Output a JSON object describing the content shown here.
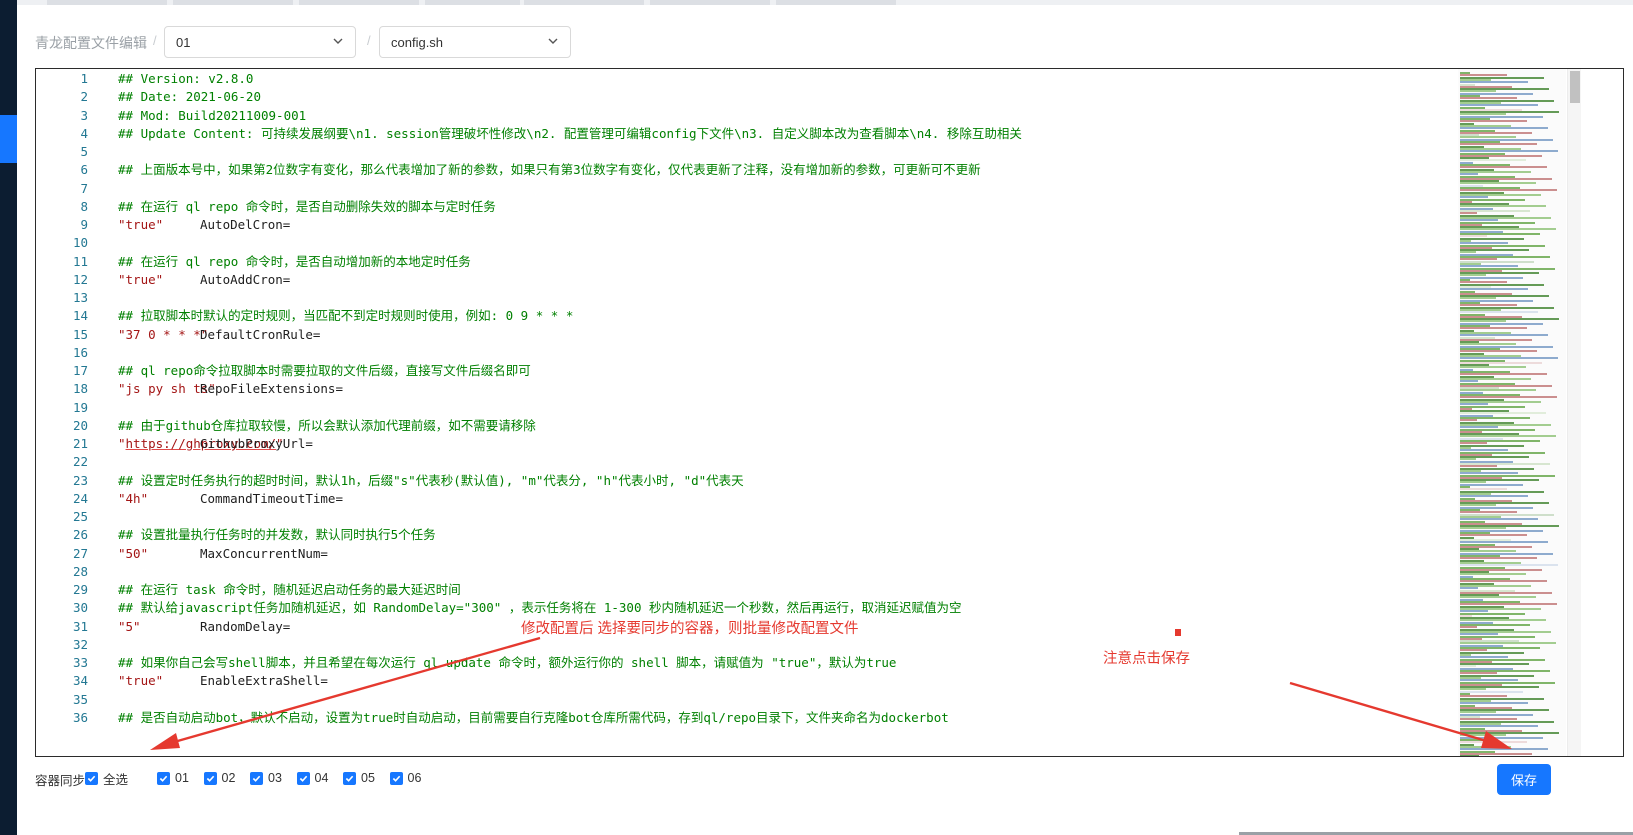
{
  "breadcrumb": {
    "title": "青龙配置文件编辑",
    "separator": "/"
  },
  "container_select": {
    "value": "01"
  },
  "file_select": {
    "value": "config.sh"
  },
  "editor": {
    "lines": [
      {
        "n": "1",
        "parts": [
          {
            "t": "## Version: v2.8.0",
            "c": "cm"
          }
        ]
      },
      {
        "n": "2",
        "parts": [
          {
            "t": "## Date: 2021-06-20",
            "c": "cm"
          }
        ]
      },
      {
        "n": "3",
        "parts": [
          {
            "t": "## Mod: Build20211009-001",
            "c": "cm"
          }
        ]
      },
      {
        "n": "4",
        "parts": [
          {
            "t": "## Update Content: 可持续发展纲要\\n1. session管理破坏性修改\\n2. 配置管理可编辑config下文件\\n3. 自定义脚本改为查看脚本\\n4. 移除互助相关",
            "c": "cm"
          }
        ]
      },
      {
        "n": "5",
        "parts": []
      },
      {
        "n": "6",
        "parts": [
          {
            "t": "## 上面版本号中，如果第2位数字有变化，那么代表增加了新的参数，如果只有第3位数字有变化，仅代表更新了注释，没有增加新的参数，可更新可不更新",
            "c": "cm"
          }
        ]
      },
      {
        "n": "7",
        "parts": []
      },
      {
        "n": "8",
        "parts": [
          {
            "t": "## 在运行 ql repo 命令时，是否自动删除失效的脚本与定时任务",
            "c": "cm"
          }
        ]
      },
      {
        "n": "9",
        "parts": [
          {
            "t": "AutoDelCron=",
            "c": "tx"
          },
          {
            "t": "\"true\"",
            "c": "str"
          }
        ]
      },
      {
        "n": "10",
        "parts": []
      },
      {
        "n": "11",
        "parts": [
          {
            "t": "## 在运行 ql repo 命令时，是否自动增加新的本地定时任务",
            "c": "cm"
          }
        ]
      },
      {
        "n": "12",
        "parts": [
          {
            "t": "AutoAddCron=",
            "c": "tx"
          },
          {
            "t": "\"true\"",
            "c": "str"
          }
        ]
      },
      {
        "n": "13",
        "parts": []
      },
      {
        "n": "14",
        "parts": [
          {
            "t": "## 拉取脚本时默认的定时规则，当匹配不到定时规则时使用，例如: 0 9 * * *",
            "c": "cm"
          }
        ]
      },
      {
        "n": "15",
        "parts": [
          {
            "t": "DefaultCronRule=",
            "c": "tx"
          },
          {
            "t": "\"37 0 * * *\"",
            "c": "str"
          }
        ]
      },
      {
        "n": "16",
        "parts": []
      },
      {
        "n": "17",
        "parts": [
          {
            "t": "## ql repo命令拉取脚本时需要拉取的文件后缀，直接写文件后缀名即可",
            "c": "cm"
          }
        ]
      },
      {
        "n": "18",
        "parts": [
          {
            "t": "RepoFileExtensions=",
            "c": "tx"
          },
          {
            "t": "\"js py sh ts\"",
            "c": "str"
          }
        ]
      },
      {
        "n": "19",
        "parts": []
      },
      {
        "n": "20",
        "parts": [
          {
            "t": "## 由于github仓库拉取较慢，所以会默认添加代理前缀，如不需要请移除",
            "c": "cm"
          }
        ]
      },
      {
        "n": "21",
        "parts": [
          {
            "t": "GithubProxyUrl=",
            "c": "tx"
          },
          {
            "t": "\"",
            "c": "str"
          },
          {
            "t": "https://ghproxy.com/",
            "c": "str url"
          },
          {
            "t": "\"",
            "c": "str"
          }
        ]
      },
      {
        "n": "22",
        "parts": []
      },
      {
        "n": "23",
        "parts": [
          {
            "t": "## 设置定时任务执行的超时时间，默认1h，后缀\"s\"代表秒(默认值), \"m\"代表分, \"h\"代表小时, \"d\"代表天",
            "c": "cm"
          }
        ]
      },
      {
        "n": "24",
        "parts": [
          {
            "t": "CommandTimeoutTime=",
            "c": "tx"
          },
          {
            "t": "\"4h\"",
            "c": "str"
          }
        ]
      },
      {
        "n": "25",
        "parts": []
      },
      {
        "n": "26",
        "parts": [
          {
            "t": "## 设置批量执行任务时的并发数，默认同时执行5个任务",
            "c": "cm"
          }
        ]
      },
      {
        "n": "27",
        "parts": [
          {
            "t": "MaxConcurrentNum=",
            "c": "tx"
          },
          {
            "t": "\"50\"",
            "c": "str"
          }
        ]
      },
      {
        "n": "28",
        "parts": []
      },
      {
        "n": "29",
        "parts": [
          {
            "t": "## 在运行 task 命令时，随机延迟启动任务的最大延迟时间",
            "c": "cm"
          }
        ]
      },
      {
        "n": "30",
        "parts": [
          {
            "t": "## 默认给javascript任务加随机延迟，如 RandomDelay=\"300\" ，表示任务将在 1-300 秒内随机延迟一个秒数，然后再运行，取消延迟赋值为空",
            "c": "cm"
          }
        ]
      },
      {
        "n": "31",
        "parts": [
          {
            "t": "RandomDelay=",
            "c": "tx"
          },
          {
            "t": "\"5\"",
            "c": "str"
          }
        ]
      },
      {
        "n": "32",
        "parts": []
      },
      {
        "n": "33",
        "parts": [
          {
            "t": "## 如果你自己会写shell脚本，并且希望在每次运行 ql update 命令时，额外运行你的 shell 脚本，请赋值为 \"true\"，默认为true",
            "c": "cm"
          }
        ]
      },
      {
        "n": "34",
        "parts": [
          {
            "t": "EnableExtraShell=",
            "c": "tx"
          },
          {
            "t": "\"true\"",
            "c": "str"
          }
        ]
      },
      {
        "n": "35",
        "parts": []
      },
      {
        "n": "36",
        "parts": [
          {
            "t": "## 是否自动启动bot，默认不启动，设置为true时自动启动，目前需要自行克隆bot仓库所需代码，存到ql/repo目录下，文件夹命名为dockerbot",
            "c": "cm"
          }
        ]
      }
    ]
  },
  "sync": {
    "label": "容器同步",
    "select_all": "全选",
    "containers": [
      "01",
      "02",
      "03",
      "04",
      "05",
      "06"
    ]
  },
  "save_label": "保存",
  "annotations": {
    "sync_hint": "修改配置后 选择要同步的容器，则批量修改配置文件",
    "save_hint": "注意点击保存"
  },
  "colors": {
    "primary": "#1677ff",
    "comment": "#008000",
    "string": "#a31515",
    "annotation": "#e5392f"
  }
}
